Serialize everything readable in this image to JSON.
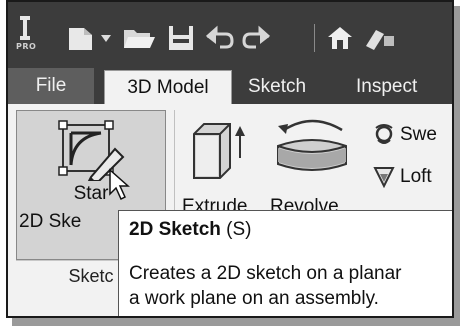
{
  "app": {
    "logo_text": "PRO"
  },
  "quick_access": {
    "icons": [
      "new-file-icon",
      "dropdown-arrow-icon",
      "open-folder-icon",
      "save-icon",
      "undo-icon",
      "redo-icon",
      "home-icon",
      "appearance-icon"
    ]
  },
  "tabs": [
    {
      "label": "File",
      "active": false
    },
    {
      "label": "3D Model",
      "active": true
    },
    {
      "label": "Sketch",
      "active": false
    },
    {
      "label": "Inspect",
      "active": false
    }
  ],
  "ribbon": {
    "start_sketch": {
      "line1": "Star",
      "line2": "2D Ske"
    },
    "panel_label": "Sketc",
    "extrude_label": "Extrude",
    "revolve_label": "Revolve",
    "sweep_label": "Swe",
    "loft_label": "Loft"
  },
  "tooltip": {
    "title_bold": "2D Sketch",
    "title_shortcut": "(S)",
    "desc_line1": "Creates a 2D sketch on a planar",
    "desc_line2": "a work plane on an assembly."
  }
}
